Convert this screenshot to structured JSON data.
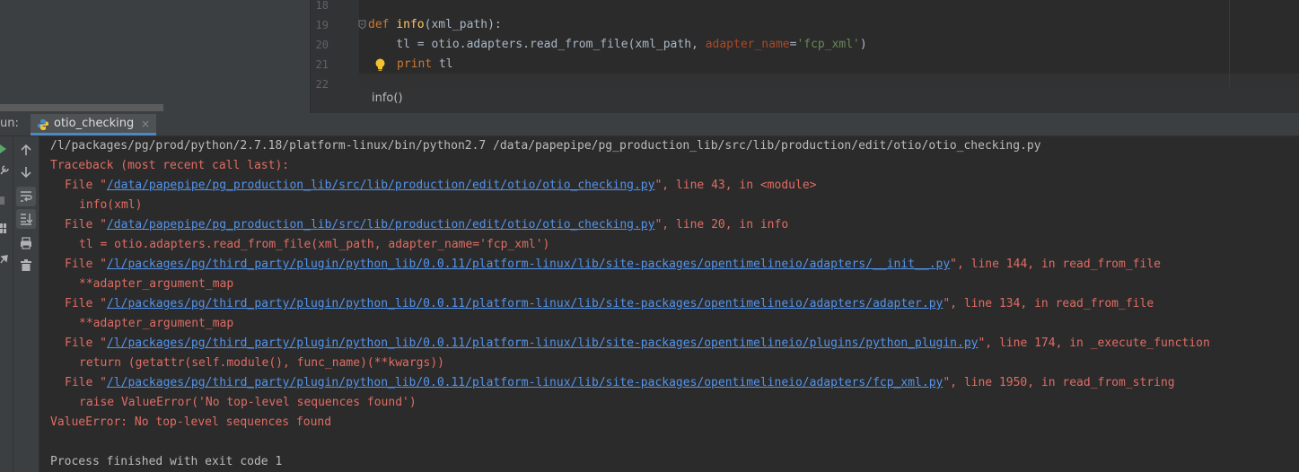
{
  "editor": {
    "lines": [
      {
        "num": "18"
      },
      {
        "num": "19",
        "kw": "def ",
        "fn": "info",
        "rest": "(xml_path):"
      },
      {
        "num": "20",
        "p1": "    tl = otio.adapters.read_from_file(xml_path, ",
        "param": "adapter_name",
        "eq": "=",
        "str": "'fcp_xml'",
        "close": ")"
      },
      {
        "num": "21",
        "kw": "print",
        "rest": " tl"
      },
      {
        "num": "22"
      }
    ],
    "breadcrumb": "info()",
    "colors": {
      "keyword": "#cc7832",
      "function": "#ffc66d",
      "string": "#6a8759",
      "param": "#aa4926"
    }
  },
  "run": {
    "label": "un:",
    "tab_label": "otio_checking",
    "tab_close": "×",
    "icons": [
      "run-icon",
      "wrench-icon",
      "stop-icon",
      "layout-icon",
      "pin-icon",
      "up-arrow-icon",
      "down-arrow-icon",
      "soft-wrap-icon",
      "scroll-to-end-icon",
      "print-icon",
      "trash-icon"
    ]
  },
  "console": {
    "command": "/l/packages/pg/prod/python/2.7.18/platform-linux/bin/python2.7 /data/papepipe/pg_production_lib/src/lib/production/edit/otio/otio_checking.py",
    "traceback_header": "Traceback (most recent call last):",
    "frames": [
      {
        "pre": "File \"",
        "path": "/data/papepipe/pg_production_lib/src/lib/production/edit/otio/otio_checking.py",
        "post": "\", line 43, in <module>",
        "code": "info(xml)"
      },
      {
        "pre": "File \"",
        "path": "/data/papepipe/pg_production_lib/src/lib/production/edit/otio/otio_checking.py",
        "post": "\", line 20, in info",
        "code": "tl = otio.adapters.read_from_file(xml_path, adapter_name='fcp_xml')"
      },
      {
        "pre": "File \"",
        "path": "/l/packages/pg/third_party/plugin/python_lib/0.0.11/platform-linux/lib/site-packages/opentimelineio/adapters/__init__.py",
        "post": "\", line 144, in read_from_file",
        "code": "**adapter_argument_map"
      },
      {
        "pre": "File \"",
        "path": "/l/packages/pg/third_party/plugin/python_lib/0.0.11/platform-linux/lib/site-packages/opentimelineio/adapters/adapter.py",
        "post": "\", line 134, in read_from_file",
        "code": "**adapter_argument_map"
      },
      {
        "pre": "File \"",
        "path": "/l/packages/pg/third_party/plugin/python_lib/0.0.11/platform-linux/lib/site-packages/opentimelineio/plugins/python_plugin.py",
        "post": "\", line 174, in _execute_function",
        "code": "return (getattr(self.module(), func_name)(**kwargs))"
      },
      {
        "pre": "File \"",
        "path": "/l/packages/pg/third_party/plugin/python_lib/0.0.11/platform-linux/lib/site-packages/opentimelineio/adapters/fcp_xml.py",
        "post": "\", line 1950, in read_from_string",
        "code": "raise ValueError('No top-level sequences found')"
      }
    ],
    "error": "ValueError: No top-level sequences found",
    "exit": "Process finished with exit code 1",
    "colors": {
      "error": "#e06c63",
      "link": "#5394ec",
      "plain": "#bbbbbb"
    }
  }
}
